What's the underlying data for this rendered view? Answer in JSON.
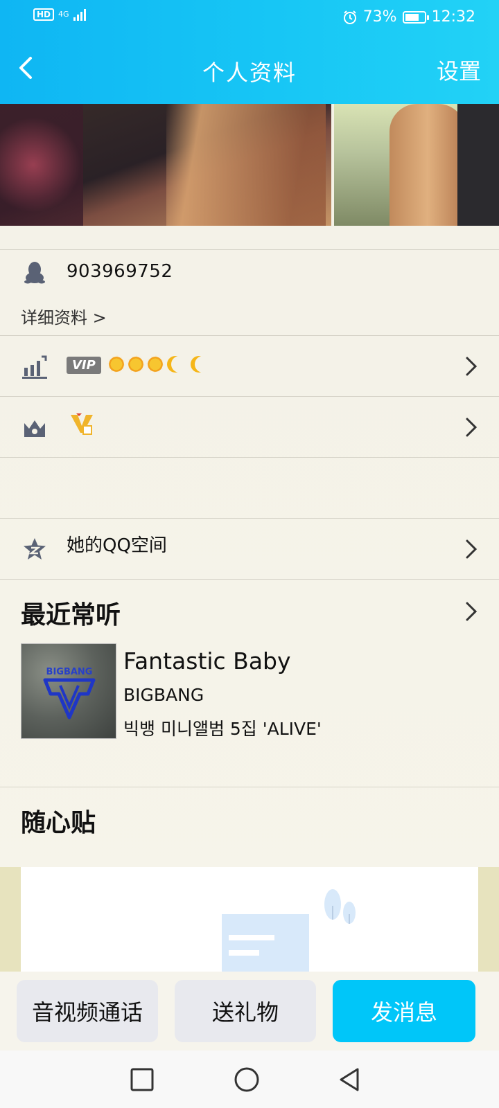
{
  "status_bar": {
    "hd": "HD",
    "network": "4G",
    "battery_percent": "73%",
    "battery_level": 0.73,
    "time": "12:32"
  },
  "header": {
    "title": "个人资料",
    "settings_label": "设置",
    "back_icon": "chevron-left-icon",
    "background_color": "#16c2f5"
  },
  "profile": {
    "qq_number": "903969752",
    "detail_link": "详细资料 >"
  },
  "vip_row": {
    "badge": "VIP",
    "level_icons": [
      "sun",
      "sun",
      "sun",
      "moon",
      "moon"
    ]
  },
  "qzone": {
    "label": "她的QQ空间"
  },
  "recent_music": {
    "title": "最近常听",
    "song": "Fantastic Baby",
    "artist": "BIGBANG",
    "album": "빅뱅 미니앨범 5집 'ALIVE'",
    "album_art_text": "BIGBANG"
  },
  "sticker": {
    "title": "随心贴"
  },
  "actions": {
    "call": "音视频通话",
    "gift": "送礼物",
    "message": "发消息",
    "primary_color": "#00c6f9"
  }
}
